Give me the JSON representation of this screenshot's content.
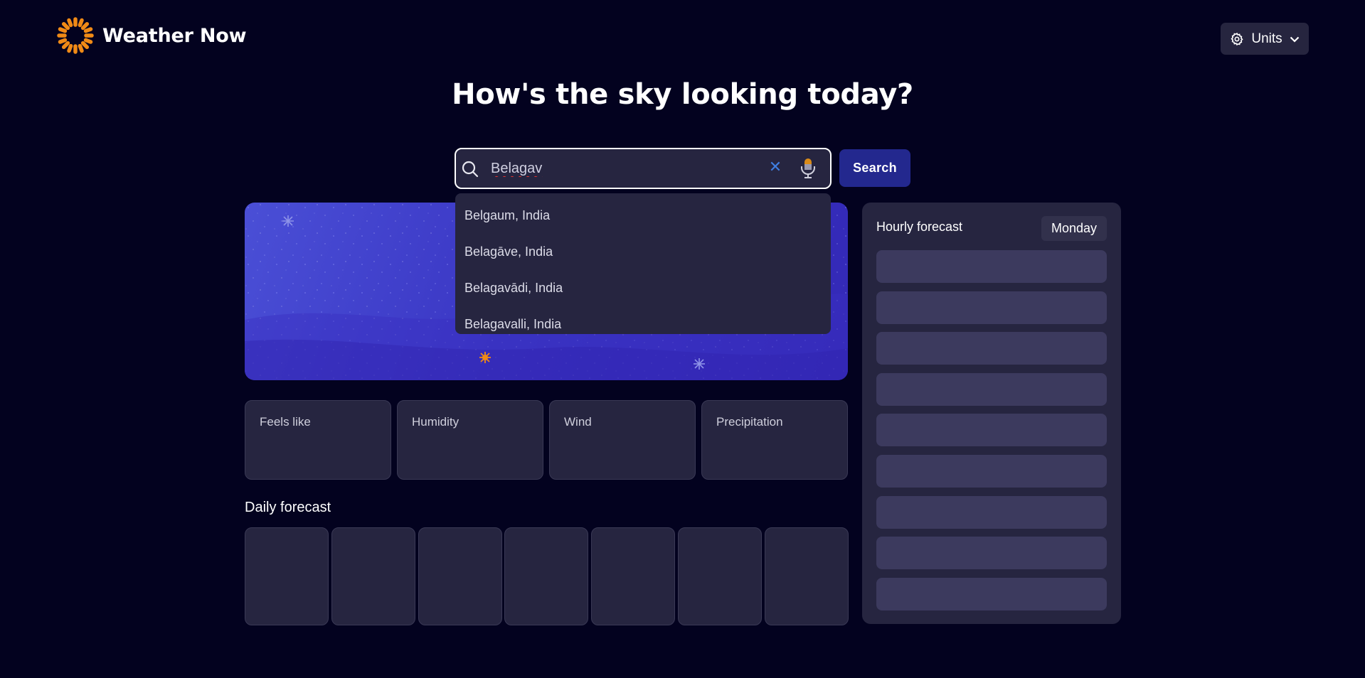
{
  "header": {
    "app_name": "Weather Now",
    "units_label": "Units"
  },
  "headline": "How's the sky looking today?",
  "search": {
    "value": "Belagav",
    "button_label": "Search",
    "suggestions": [
      "Belgaum, India",
      "Belagāve, India",
      "Belagavādi, India",
      "Belagavalli, India"
    ]
  },
  "stats": {
    "feels_like": "Feels like",
    "humidity": "Humidity",
    "wind": "Wind",
    "precipitation": "Precipitation"
  },
  "daily": {
    "title": "Daily forecast"
  },
  "hourly": {
    "title": "Hourly forecast",
    "day": "Monday"
  },
  "colors": {
    "background": "#03021f",
    "card": "#262540",
    "accent_orange": "#f08a16",
    "search_button": "#23288e",
    "hero": "#3a36c4",
    "hour_placeholder": "#3c3a5e"
  }
}
